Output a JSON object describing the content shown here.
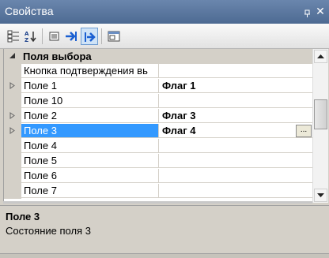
{
  "window": {
    "title": "Свойства"
  },
  "toolbar": {
    "buttons": [
      "categorized-icon",
      "alphabetical-icon",
      "properties-icon",
      "events-icon",
      "events-active-icon",
      "property-pages-icon"
    ]
  },
  "grid": {
    "category": {
      "label": "Поля выбора",
      "expanded": true
    },
    "rows": [
      {
        "name": "Кнопка подтверждения вь",
        "value": "",
        "expandable": false,
        "selected": false
      },
      {
        "name": "Поле 1",
        "value": "Флаг 1",
        "expandable": true,
        "selected": false
      },
      {
        "name": "Поле 10",
        "value": "",
        "expandable": false,
        "selected": false
      },
      {
        "name": "Поле 2",
        "value": "Флаг 3",
        "expandable": true,
        "selected": false
      },
      {
        "name": "Поле 3",
        "value": "Флаг 4",
        "expandable": true,
        "selected": true
      },
      {
        "name": "Поле 4",
        "value": "",
        "expandable": false,
        "selected": false
      },
      {
        "name": "Поле 5",
        "value": "",
        "expandable": false,
        "selected": false
      },
      {
        "name": "Поле 6",
        "value": "",
        "expandable": false,
        "selected": false
      },
      {
        "name": "Поле 7",
        "value": "",
        "expandable": false,
        "selected": false
      }
    ]
  },
  "description": {
    "title": "Поле 3",
    "text": "Состояние поля 3"
  },
  "colors": {
    "selection": "#3399ff",
    "titlebar": "#5b78a0"
  }
}
